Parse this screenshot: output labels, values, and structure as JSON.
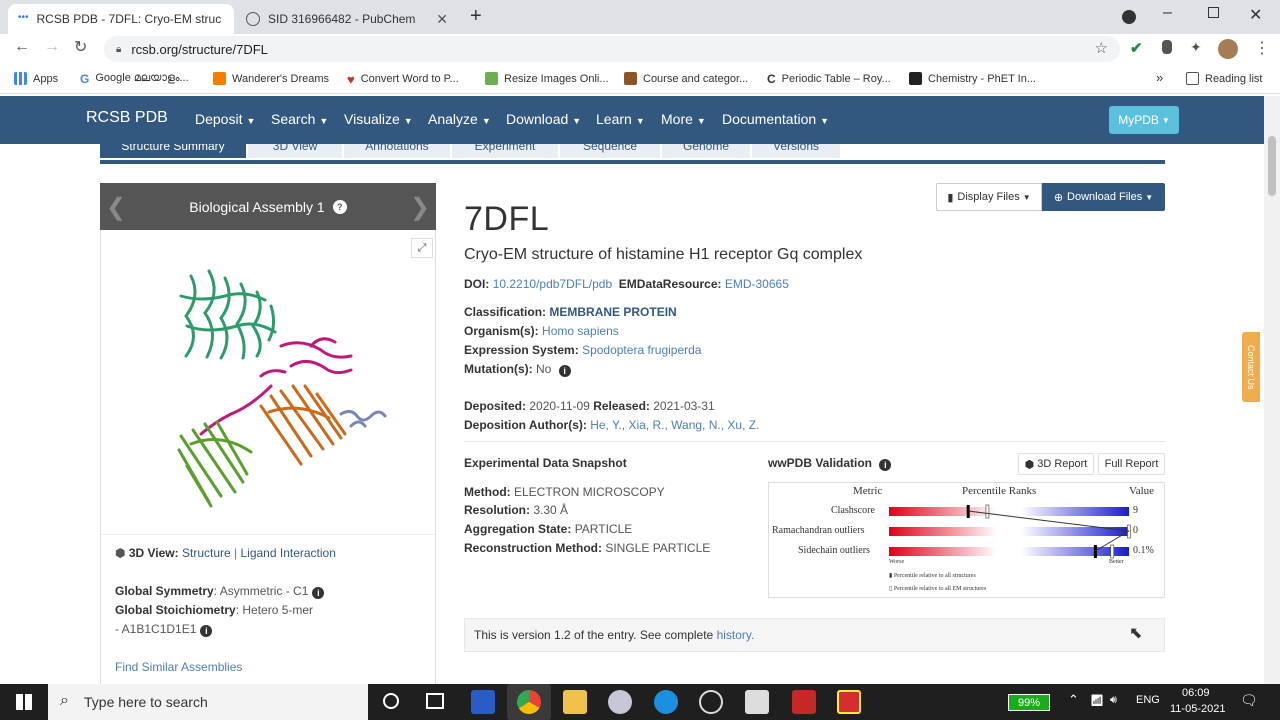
{
  "browser": {
    "tabs": [
      {
        "title": "RCSB PDB - 7DFL: Cryo-EM struc",
        "active": true
      },
      {
        "title": "SID 316966482 - PubChem",
        "active": false
      }
    ],
    "url": "rcsb.org/structure/7DFL",
    "bookmarks": [
      {
        "label": "Apps",
        "icon": "apps-grid-icon"
      },
      {
        "label": "Google മലയാളം...",
        "icon": "google-icon"
      },
      {
        "label": "Wanderer's Dreams",
        "icon": "blogger-icon"
      },
      {
        "label": "Convert Word to P...",
        "icon": "heart-icon"
      },
      {
        "label": "Resize Images Onli...",
        "icon": "resize-icon"
      },
      {
        "label": "Course and categor...",
        "icon": "course-icon"
      },
      {
        "label": "Periodic Table – Roy...",
        "icon": "c-icon"
      },
      {
        "label": "Chemistry - PhET In...",
        "icon": "phet-icon"
      }
    ],
    "reading_list": "Reading list",
    "more_bookmarks": "»"
  },
  "navbar": {
    "brand": "RCSB PDB",
    "items": [
      "Deposit",
      "Search",
      "Visualize",
      "Analyze",
      "Download",
      "Learn",
      "More",
      "Documentation"
    ],
    "mypdb": "MyPDB"
  },
  "subtabs": [
    "Structure Summary",
    "3D View",
    "Annotations",
    "Experiment",
    "Sequence",
    "Genome",
    "Versions"
  ],
  "assembly": {
    "title": "Biological Assembly 1",
    "view_label": "3D View:",
    "view_structure": "Structure",
    "view_sep": "|",
    "view_ligand": "Ligand Interaction",
    "symmetry_label": "Global Symmetry",
    "symmetry_value": ": Asymmetric - C1",
    "stoich_label": "Global Stoichiometry",
    "stoich_value": ": Hetero 5-mer",
    "stoich_value2": "- A1B1C1D1E1",
    "similar": "Find Similar Assemblies"
  },
  "entry": {
    "id": "7DFL",
    "title": "Cryo-EM structure of histamine H1 receptor Gq complex",
    "doi_label": "DOI:",
    "doi": "10.2210/pdb7DFL/pdb",
    "emdb_label": "EMDataResource:",
    "emdb": "EMD-30665",
    "classification_label": "Classification:",
    "classification": "MEMBRANE PROTEIN",
    "organism_label": "Organism(s):",
    "organism": "Homo sapiens",
    "expression_label": "Expression System:",
    "expression": "Spodoptera frugiperda",
    "mutation_label": "Mutation(s):",
    "mutation": "No",
    "deposited_label": "Deposited:",
    "deposited": "2020-11-09",
    "released_label": "Released:",
    "released": "2021-03-31",
    "authors_label": "Deposition Author(s):",
    "authors": "He, Y., Xia, R., Wang, N., Xu, Z."
  },
  "files": {
    "display": "Display Files",
    "download": "Download Files"
  },
  "experimental": {
    "heading": "Experimental Data Snapshot",
    "method_label": "Method:",
    "method": "ELECTRON MICROSCOPY",
    "resolution_label": "Resolution:",
    "resolution": "3.30 Å",
    "aggregation_label": "Aggregation State:",
    "aggregation": "PARTICLE",
    "reconstruction_label": "Reconstruction Method:",
    "reconstruction": "SINGLE PARTICLE"
  },
  "validation": {
    "heading": "wwPDB Validation",
    "report3d": "3D Report",
    "full_report": "Full Report",
    "col_metric": "Metric",
    "col_ranks": "Percentile Ranks",
    "col_value": "Value",
    "metrics": [
      {
        "name": "Clashscore",
        "value": "9",
        "pct_all": 0.33,
        "pct_em": 0.41
      },
      {
        "name": "Ramachandran outliers",
        "value": "0",
        "pct_all": 1.0,
        "pct_em": 1.0
      },
      {
        "name": "Sidechain outliers",
        "value": "0.1%",
        "pct_all": 0.86,
        "pct_em": 0.93
      }
    ],
    "worse": "Worse",
    "better": "Better",
    "legend_all": "Percentile relative to all structures",
    "legend_em": "Percentile relative to all EM structures"
  },
  "version_note": {
    "text": "This is version 1.2 of the entry. See complete",
    "link": "history."
  },
  "contact": "Contact Us",
  "taskbar": {
    "search_placeholder": "Type here to search",
    "battery": "99%",
    "lang": "ENG",
    "time": "06:09",
    "date": "11-05-2021"
  }
}
